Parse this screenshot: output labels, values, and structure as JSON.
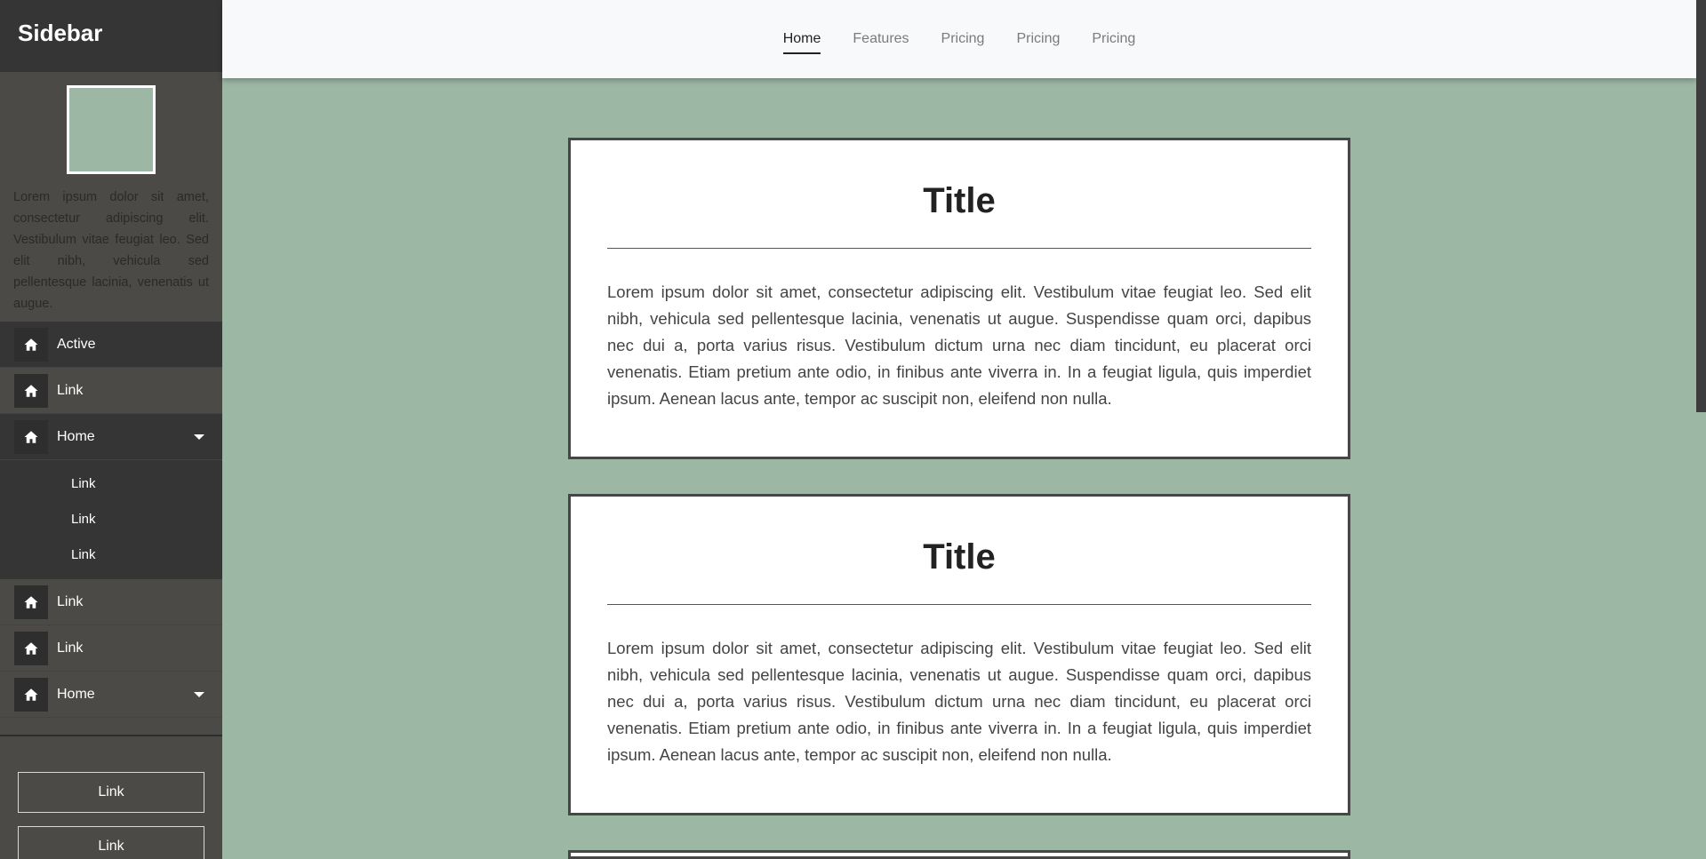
{
  "sidebar": {
    "brand": "Sidebar",
    "about": "Lorem ipsum dolor sit amet, consectetur adipiscing elit. Vestibulum vitae feugiat leo. Sed elit nibh, vehicula sed pellentesque lacinia, venenatis ut augue.",
    "items": [
      {
        "label": "Active",
        "icon": "home-icon"
      },
      {
        "label": "Link",
        "icon": "home-icon"
      },
      {
        "label": "Home",
        "icon": "home-icon"
      },
      {
        "label": "Link",
        "icon": "home-icon"
      },
      {
        "label": "Link",
        "icon": "home-icon"
      },
      {
        "label": "Home",
        "icon": "home-icon"
      }
    ],
    "submenu": [
      "Link",
      "Link",
      "Link"
    ],
    "buttons": [
      "Link",
      "Link"
    ]
  },
  "topnav": {
    "links": [
      "Home",
      "Features",
      "Pricing",
      "Pricing",
      "Pricing"
    ]
  },
  "cards": [
    {
      "title": "Title",
      "text": "Lorem ipsum dolor sit amet, consectetur adipiscing elit. Vestibulum vitae feugiat leo. Sed elit nibh, vehicula sed pellentesque lacinia, venenatis ut augue. Suspendisse quam orci, dapibus nec dui a, porta varius risus. Vestibulum dictum urna nec diam tincidunt, eu placerat orci venenatis. Etiam pretium ante odio, in finibus ante viverra in. In a feugiat ligula, quis imperdiet ipsum. Aenean lacus ante, tempor ac suscipit non, eleifend non nulla."
    },
    {
      "title": "Title",
      "text": "Lorem ipsum dolor sit amet, consectetur adipiscing elit. Vestibulum vitae feugiat leo. Sed elit nibh, vehicula sed pellentesque lacinia, venenatis ut augue. Suspendisse quam orci, dapibus nec dui a, porta varius risus. Vestibulum dictum urna nec diam tincidunt, eu placerat orci venenatis. Etiam pretium ante odio, in finibus ante viverra in. In a feugiat ligula, quis imperdiet ipsum. Aenean lacus ante, tempor ac suscipit non, eleifend non nulla."
    }
  ],
  "colors": {
    "background": "#9db7a5",
    "sidebar": "#4b4a47",
    "sidebar_dark": "#353535",
    "topbar": "#f8f9fa"
  }
}
